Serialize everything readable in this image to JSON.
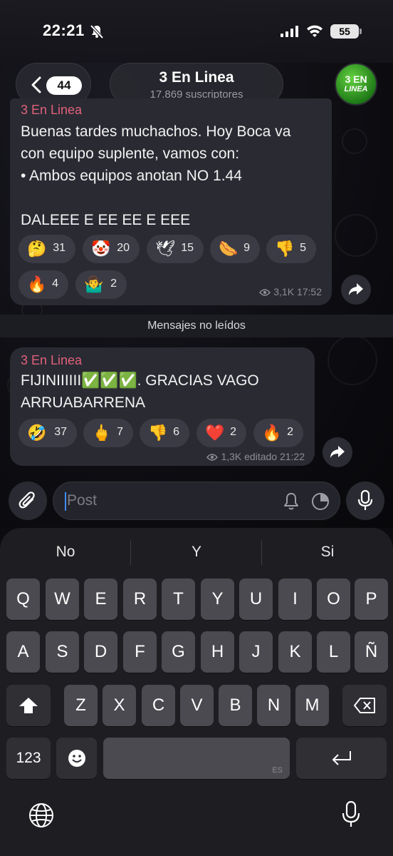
{
  "status_bar": {
    "time": "22:21",
    "battery": "55"
  },
  "header": {
    "unread_count": "44",
    "channel_name": "3 En Linea",
    "subscribers": "17.869 suscriptores",
    "avatar_text_top": "3 EN",
    "avatar_text_bottom": "LINEA"
  },
  "messages": [
    {
      "sender": "3 En Linea",
      "text": "Buenas tardes muchachos. Hoy Boca va\ncon equipo suplente, vamos con:\n• Ambos equipos anotan NO 1.44\n\nDALEEE E EE EE E EEE",
      "reactions": [
        {
          "emoji": "🤔",
          "count": "31"
        },
        {
          "emoji": "🤡",
          "count": "20"
        },
        {
          "emoji": "🕊",
          "count": "15"
        },
        {
          "emoji": "🌭",
          "count": "9"
        },
        {
          "emoji": "👎",
          "count": "5"
        },
        {
          "emoji": "🔥",
          "count": "4"
        },
        {
          "emoji": "🤷‍♂️",
          "count": "2"
        }
      ],
      "views": "3,1K",
      "time": "17:52"
    },
    {
      "sender": "3 En Linea",
      "text": "FIJINIIIIII✅✅✅. GRACIAS VAGO\nARRUABARRENA",
      "reactions": [
        {
          "emoji": "🤣",
          "count": "37"
        },
        {
          "emoji": "🖕",
          "count": "7"
        },
        {
          "emoji": "👎",
          "count": "6"
        },
        {
          "emoji": "❤️",
          "count": "2"
        },
        {
          "emoji": "🔥",
          "count": "2"
        }
      ],
      "views": "1,3K",
      "time": "editado 21:22"
    }
  ],
  "unread_divider": "Mensajes no leídos",
  "input": {
    "placeholder": "Post"
  },
  "keyboard": {
    "suggestions": [
      "No",
      "Y",
      "Si"
    ],
    "row1": [
      "Q",
      "W",
      "E",
      "R",
      "T",
      "Y",
      "U",
      "I",
      "O",
      "P"
    ],
    "row2": [
      "A",
      "S",
      "D",
      "F",
      "G",
      "H",
      "J",
      "K",
      "L",
      "Ñ"
    ],
    "row3": [
      "Z",
      "X",
      "C",
      "V",
      "B",
      "N",
      "M"
    ],
    "numbers_key": "123",
    "space_language": "ES"
  },
  "colors": {
    "sender": "#e0627a",
    "bubble": "#2a2a33",
    "caret": "#3f8cff"
  }
}
